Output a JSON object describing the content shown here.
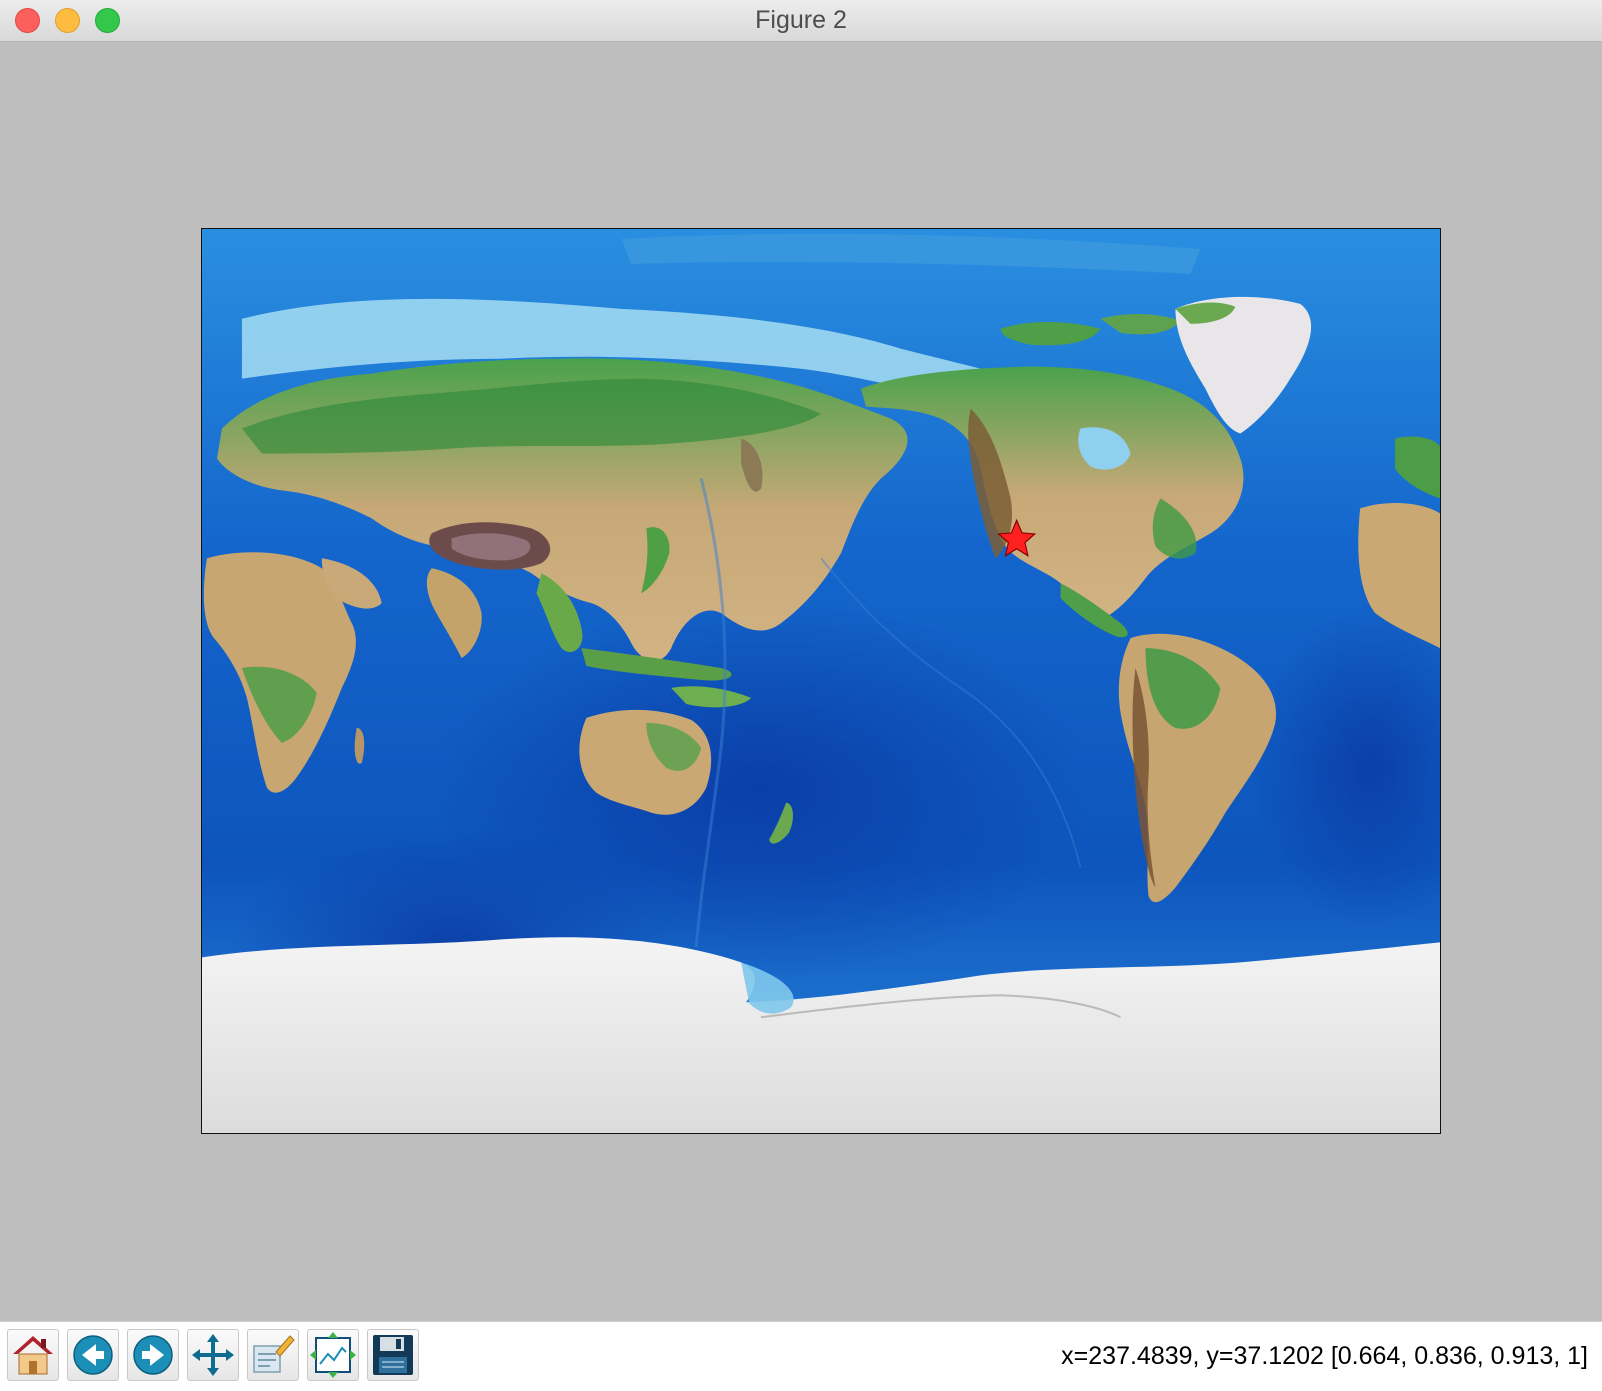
{
  "window": {
    "title": "Figure 2",
    "controls": {
      "close": "close-button",
      "minimize": "minimize-button",
      "zoom": "zoom-button"
    }
  },
  "map": {
    "projection": "equirectangular world relief (Pacific-centered)",
    "marker": {
      "symbol": "star",
      "color": "#ff2020"
    },
    "colors": {
      "deep_ocean": "#0a3fa8",
      "ocean": "#1469cf",
      "shallow": "#78c8ec",
      "land_low": "#3e9a46",
      "land_mid": "#c9a97a",
      "land_high": "#8a6a3c",
      "ice": "#ececec"
    }
  },
  "toolbar": {
    "buttons": [
      {
        "icon": "home-icon"
      },
      {
        "icon": "back-arrow-icon"
      },
      {
        "icon": "forward-arrow-icon"
      },
      {
        "icon": "pan-arrows-icon"
      },
      {
        "icon": "zoom-rect-icon"
      },
      {
        "icon": "subplots-config-icon"
      },
      {
        "icon": "save-floppy-icon"
      }
    ],
    "status": "x=237.4839, y=37.1202 [0.664, 0.836, 0.913, 1]"
  }
}
